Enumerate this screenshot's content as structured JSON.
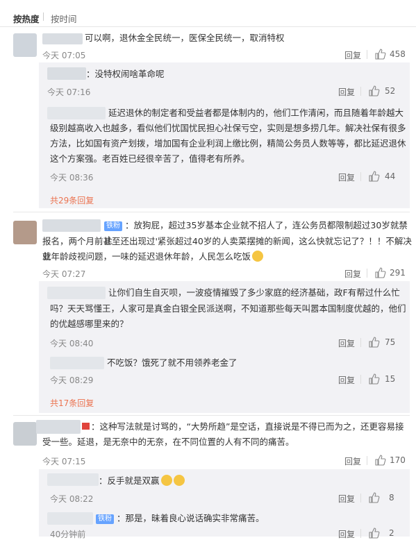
{
  "tabs": {
    "hot": "按热度",
    "time": "按时间"
  },
  "reply_label": "回复",
  "c1": {
    "text": "可以啊，退休金全民统一，医保全民统一，取消特权",
    "time": "今天 07:05",
    "likes": "458",
    "r1": {
      "text": "：没特权闹啥革命呢",
      "time": "今天 07:16",
      "likes": "52"
    },
    "r2": {
      "l1": "延迟退休的制定者和受益者都是体制内的，他们工作清闲，而且随着年龄越大",
      "l2": "级别越高收入也越多，看似他们忧国忧民担心社保亏空，实则是想多捞几年。解决社保有很多",
      "l3": "方法，比如国有资产划拨，增加国有企业利润上缴比例，精简公务员人数等等，都比延迟退休",
      "l4": "这个方案强。老百姓已经很辛苦了，值得老有所养。",
      "time": "今天 08:36",
      "likes": "44"
    },
    "more": "共29条回复"
  },
  "c2": {
    "badge": "铁粉",
    "l1": "：放狗屁，超过35岁基本企业就不招人了，连公务员都限制超过30岁就禁止",
    "l2": "报名，两个月前甚至还出现过'紧张超过40岁的人卖菜摆摊的新闻，这么快就忘记了？！！不解决就",
    "l3": "业年龄歧视问题，一味的延迟退休年龄，人民怎么吃饭",
    "time": "今天 07:27",
    "likes": "291",
    "r1": {
      "l1": "让你们自生自灭呗，一波疫情摧毁了多少家庭的经济基础，政F有帮过什么忙",
      "l2": "吗？天天骂懂王，人家可是真金白银全民派送啊，不知道那些每天叫嚣本国制度优越的，他们",
      "l3": "的优越感哪里来的？",
      "time": "今天 08:40",
      "likes": "75"
    },
    "r2": {
      "text": "不吃饭？饿死了就不用领养老金了",
      "time": "今天 08:29",
      "likes": "15"
    },
    "more": "共17条回复"
  },
  "c3": {
    "l1": "：这种写法就是讨骂的，“大势所趋”是空话，直接说是不得已而为之，还更容易接",
    "l2": "受一些。延退，是无奈中的无奈，在不同位置的人有不同的痛苦。",
    "time": "今天 07:15",
    "likes": "170",
    "r1": {
      "text": "：反手就是双赢",
      "time": "今天 08:22",
      "likes": "8"
    },
    "r2": {
      "badge": "铁粉",
      "text": "：那是，昧着良心说话确实非常痛苦。",
      "time": "40分钟前",
      "likes": "2"
    }
  }
}
